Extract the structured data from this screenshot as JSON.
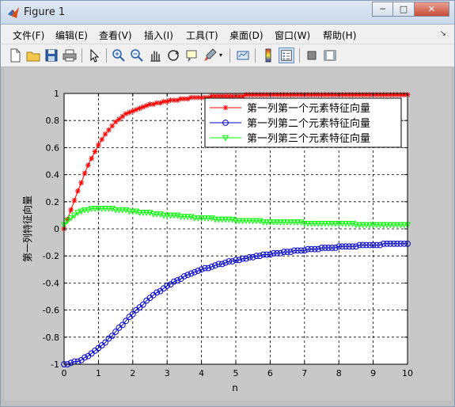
{
  "window": {
    "title": "Figure 1",
    "controls": {
      "minimize": "─",
      "maximize": "□",
      "close": "✕"
    }
  },
  "menu": [
    "文件(F)",
    "编辑(E)",
    "查看(V)",
    "插入(I)",
    "工具(T)",
    "桌面(D)",
    "窗口(W)",
    "帮助(H)"
  ],
  "toolbar": [
    "new-figure-icon",
    "open-file-icon",
    "save-icon",
    "print-icon",
    "pointer-icon",
    "zoom-in-icon",
    "zoom-out-icon",
    "pan-hand-icon",
    "rotate-3d-icon",
    "data-cursor-icon",
    "brush-icon",
    "link-plot-icon",
    "colorbar-icon",
    "legend-icon",
    "hide-plot-tools-icon",
    "show-plot-tools-icon"
  ],
  "colors": {
    "series1": "#ff0000",
    "series2": "#0000cc",
    "series3": "#00ff00",
    "figure_bg": "#c8c8c8"
  },
  "chart_data": {
    "type": "line",
    "title": "",
    "xlabel": "n",
    "ylabel": "第一列特征向量",
    "xlim": [
      0,
      10
    ],
    "ylim": [
      -1,
      1
    ],
    "xticks": [
      0,
      1,
      2,
      3,
      4,
      5,
      6,
      7,
      8,
      9,
      10
    ],
    "yticks": [
      -1,
      -0.8,
      -0.6,
      -0.4,
      -0.2,
      0,
      0.2,
      0.4,
      0.6,
      0.8,
      1
    ],
    "grid": true,
    "grid_style": "dashed",
    "legend_position": "top-right",
    "x": [
      0,
      0.1,
      0.2,
      0.3,
      0.4,
      0.5,
      0.6,
      0.7,
      0.8,
      0.9,
      1.0,
      1.1,
      1.2,
      1.3,
      1.4,
      1.5,
      1.6,
      1.7,
      1.8,
      1.9,
      2.0,
      2.1,
      2.2,
      2.3,
      2.4,
      2.5,
      2.6,
      2.7,
      2.8,
      2.9,
      3.0,
      3.1,
      3.2,
      3.3,
      3.4,
      3.5,
      3.6,
      3.7,
      3.8,
      3.9,
      4.0,
      4.1,
      4.2,
      4.3,
      4.4,
      4.5,
      4.6,
      4.7,
      4.8,
      4.9,
      5.0,
      5.1,
      5.2,
      5.3,
      5.4,
      5.5,
      5.6,
      5.7,
      5.8,
      5.9,
      6.0,
      6.1,
      6.2,
      6.3,
      6.4,
      6.5,
      6.6,
      6.7,
      6.8,
      6.9,
      7.0,
      7.1,
      7.2,
      7.3,
      7.4,
      7.5,
      7.6,
      7.7,
      7.8,
      7.9,
      8.0,
      8.1,
      8.2,
      8.3,
      8.4,
      8.5,
      8.6,
      8.7,
      8.8,
      8.9,
      9.0,
      9.1,
      9.2,
      9.3,
      9.4,
      9.5,
      9.6,
      9.7,
      9.8,
      9.9,
      10.0
    ],
    "series": [
      {
        "name": "第一列第一个元素特征向量",
        "color": "#ff0000",
        "marker": "*",
        "values": [
          0.0,
          0.07,
          0.14,
          0.21,
          0.28,
          0.34,
          0.41,
          0.47,
          0.52,
          0.57,
          0.62,
          0.66,
          0.7,
          0.73,
          0.76,
          0.79,
          0.81,
          0.83,
          0.85,
          0.86,
          0.87,
          0.88,
          0.89,
          0.9,
          0.91,
          0.92,
          0.92,
          0.93,
          0.93,
          0.94,
          0.94,
          0.95,
          0.95,
          0.95,
          0.96,
          0.96,
          0.96,
          0.97,
          0.97,
          0.97,
          0.97,
          0.97,
          0.97,
          0.98,
          0.98,
          0.98,
          0.98,
          0.98,
          0.98,
          0.98,
          0.98,
          0.98,
          0.98,
          0.99,
          0.99,
          0.99,
          0.99,
          0.99,
          0.99,
          0.99,
          0.99,
          0.99,
          0.99,
          0.99,
          0.99,
          0.99,
          0.99,
          0.99,
          0.99,
          0.99,
          0.99,
          0.99,
          0.99,
          0.99,
          0.99,
          0.99,
          0.99,
          0.99,
          0.99,
          0.99,
          0.99,
          0.99,
          0.99,
          0.99,
          0.99,
          0.99,
          0.99,
          0.99,
          0.99,
          0.99,
          0.99,
          0.99,
          0.99,
          0.99,
          0.99,
          0.99,
          0.99,
          0.99,
          0.99,
          0.99,
          0.99
        ]
      },
      {
        "name": "第一列第二个元素特征向量",
        "color": "#0000cc",
        "marker": "o",
        "values": [
          -1.0,
          -1.0,
          -0.99,
          -0.98,
          -0.98,
          -0.97,
          -0.95,
          -0.94,
          -0.92,
          -0.9,
          -0.88,
          -0.86,
          -0.84,
          -0.81,
          -0.79,
          -0.76,
          -0.73,
          -0.71,
          -0.68,
          -0.65,
          -0.63,
          -0.6,
          -0.58,
          -0.56,
          -0.53,
          -0.51,
          -0.49,
          -0.47,
          -0.46,
          -0.44,
          -0.42,
          -0.41,
          -0.39,
          -0.38,
          -0.37,
          -0.35,
          -0.34,
          -0.33,
          -0.32,
          -0.31,
          -0.3,
          -0.29,
          -0.29,
          -0.28,
          -0.27,
          -0.26,
          -0.26,
          -0.25,
          -0.24,
          -0.24,
          -0.23,
          -0.23,
          -0.22,
          -0.22,
          -0.21,
          -0.21,
          -0.2,
          -0.2,
          -0.19,
          -0.19,
          -0.19,
          -0.18,
          -0.18,
          -0.18,
          -0.17,
          -0.17,
          -0.17,
          -0.16,
          -0.16,
          -0.16,
          -0.16,
          -0.15,
          -0.15,
          -0.15,
          -0.15,
          -0.14,
          -0.14,
          -0.14,
          -0.14,
          -0.14,
          -0.13,
          -0.13,
          -0.13,
          -0.13,
          -0.13,
          -0.13,
          -0.12,
          -0.12,
          -0.12,
          -0.12,
          -0.12,
          -0.12,
          -0.12,
          -0.11,
          -0.11,
          -0.11,
          -0.11,
          -0.11,
          -0.11,
          -0.11,
          -0.11
        ]
      },
      {
        "name": "第一列第三个元素特征向量",
        "color": "#00ff00",
        "marker": "v",
        "values": [
          0.03,
          0.06,
          0.08,
          0.1,
          0.12,
          0.13,
          0.14,
          0.14,
          0.15,
          0.15,
          0.15,
          0.15,
          0.15,
          0.15,
          0.15,
          0.14,
          0.14,
          0.14,
          0.14,
          0.13,
          0.13,
          0.13,
          0.12,
          0.12,
          0.12,
          0.12,
          0.11,
          0.11,
          0.11,
          0.1,
          0.1,
          0.1,
          0.1,
          0.1,
          0.09,
          0.09,
          0.09,
          0.09,
          0.08,
          0.08,
          0.08,
          0.08,
          0.08,
          0.08,
          0.07,
          0.07,
          0.07,
          0.07,
          0.07,
          0.07,
          0.06,
          0.06,
          0.06,
          0.06,
          0.06,
          0.06,
          0.06,
          0.06,
          0.05,
          0.05,
          0.05,
          0.05,
          0.05,
          0.05,
          0.05,
          0.05,
          0.05,
          0.05,
          0.05,
          0.05,
          0.04,
          0.04,
          0.04,
          0.04,
          0.04,
          0.04,
          0.04,
          0.04,
          0.04,
          0.04,
          0.04,
          0.04,
          0.04,
          0.04,
          0.04,
          0.03,
          0.03,
          0.03,
          0.03,
          0.03,
          0.03,
          0.03,
          0.03,
          0.03,
          0.03,
          0.03,
          0.03,
          0.03,
          0.03,
          0.03,
          0.03
        ]
      }
    ]
  }
}
